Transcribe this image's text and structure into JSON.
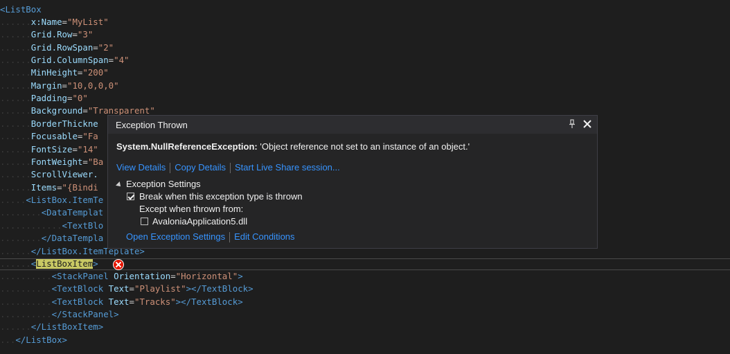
{
  "editor": {
    "lines": [
      {
        "dots": "",
        "parts": [
          {
            "c": "tag",
            "t": "<ListBox"
          }
        ]
      },
      {
        "dots": "......",
        "parts": [
          {
            "c": "attr",
            "t": "x:Name"
          },
          {
            "c": "plain",
            "t": "="
          },
          {
            "c": "val",
            "t": "\"MyList\""
          }
        ]
      },
      {
        "dots": "......",
        "parts": [
          {
            "c": "attr",
            "t": "Grid.Row"
          },
          {
            "c": "plain",
            "t": "="
          },
          {
            "c": "val",
            "t": "\"3\""
          }
        ]
      },
      {
        "dots": "......",
        "parts": [
          {
            "c": "attr",
            "t": "Grid.RowSpan"
          },
          {
            "c": "plain",
            "t": "="
          },
          {
            "c": "val",
            "t": "\"2\""
          }
        ]
      },
      {
        "dots": "......",
        "parts": [
          {
            "c": "attr",
            "t": "Grid.ColumnSpan"
          },
          {
            "c": "plain",
            "t": "="
          },
          {
            "c": "val",
            "t": "\"4\""
          }
        ]
      },
      {
        "dots": "......",
        "parts": [
          {
            "c": "attr",
            "t": "MinHeight"
          },
          {
            "c": "plain",
            "t": "="
          },
          {
            "c": "val",
            "t": "\"200\""
          }
        ]
      },
      {
        "dots": "......",
        "parts": [
          {
            "c": "attr",
            "t": "Margin"
          },
          {
            "c": "plain",
            "t": "="
          },
          {
            "c": "val",
            "t": "\"10,0,0,0\""
          }
        ]
      },
      {
        "dots": "......",
        "parts": [
          {
            "c": "attr",
            "t": "Padding"
          },
          {
            "c": "plain",
            "t": "="
          },
          {
            "c": "val",
            "t": "\"0\""
          }
        ]
      },
      {
        "dots": "......",
        "parts": [
          {
            "c": "attr",
            "t": "Background"
          },
          {
            "c": "plain",
            "t": "="
          },
          {
            "c": "val",
            "t": "\"Transparent\""
          }
        ]
      },
      {
        "dots": "......",
        "parts": [
          {
            "c": "attr",
            "t": "BorderThickne"
          }
        ]
      },
      {
        "dots": "......",
        "parts": [
          {
            "c": "attr",
            "t": "Focusable"
          },
          {
            "c": "plain",
            "t": "="
          },
          {
            "c": "val",
            "t": "\"Fa"
          }
        ]
      },
      {
        "dots": "......",
        "parts": [
          {
            "c": "attr",
            "t": "FontSize"
          },
          {
            "c": "plain",
            "t": "="
          },
          {
            "c": "val",
            "t": "\"14\""
          }
        ]
      },
      {
        "dots": "......",
        "parts": [
          {
            "c": "attr",
            "t": "FontWeight"
          },
          {
            "c": "plain",
            "t": "="
          },
          {
            "c": "val",
            "t": "\"Ba"
          }
        ]
      },
      {
        "dots": "......",
        "parts": [
          {
            "c": "attr",
            "t": "ScrollViewer."
          }
        ]
      },
      {
        "dots": "......",
        "parts": [
          {
            "c": "attr",
            "t": "Items"
          },
          {
            "c": "plain",
            "t": "="
          },
          {
            "c": "val",
            "t": "\"{Bindi"
          }
        ]
      },
      {
        "dots": ".....",
        "parts": [
          {
            "c": "tag",
            "t": "<ListBox.ItemTe"
          }
        ]
      },
      {
        "dots": "........",
        "parts": [
          {
            "c": "tag",
            "t": "<DataTemplat"
          }
        ]
      },
      {
        "dots": "............",
        "parts": [
          {
            "c": "tag",
            "t": "<TextBlo"
          }
        ]
      },
      {
        "dots": "........",
        "parts": [
          {
            "c": "tag",
            "t": "</DataTempla"
          }
        ]
      },
      {
        "dots": "......",
        "parts": [
          {
            "c": "tag",
            "t": "</ListBox.ItemTe"
          },
          {
            "c": "tag",
            "t": "plate>"
          }
        ]
      },
      {
        "dots": "......",
        "parts": [
          {
            "c": "tag",
            "t": "<"
          },
          {
            "c": "hl",
            "t": "ListBoxItem"
          },
          {
            "c": "tag",
            "t": ">"
          }
        ]
      },
      {
        "dots": "..........",
        "parts": [
          {
            "c": "tag",
            "t": "<StackPanel "
          },
          {
            "c": "attr",
            "t": "Orientation"
          },
          {
            "c": "plain",
            "t": "="
          },
          {
            "c": "val",
            "t": "\"Horizontal\""
          },
          {
            "c": "tag",
            "t": ">"
          }
        ]
      },
      {
        "dots": "..........",
        "parts": [
          {
            "c": "tag",
            "t": "<TextBlock "
          },
          {
            "c": "attr",
            "t": "Text"
          },
          {
            "c": "plain",
            "t": "="
          },
          {
            "c": "val",
            "t": "\"Playlist\""
          },
          {
            "c": "tag",
            "t": "></TextBlock>"
          }
        ]
      },
      {
        "dots": "..........",
        "parts": [
          {
            "c": "tag",
            "t": "<TextBlock "
          },
          {
            "c": "attr",
            "t": "Text"
          },
          {
            "c": "plain",
            "t": "="
          },
          {
            "c": "val",
            "t": "\"Tracks\""
          },
          {
            "c": "tag",
            "t": "></TextBlock>"
          }
        ]
      },
      {
        "dots": "..........",
        "parts": [
          {
            "c": "tag",
            "t": "</StackPanel>"
          }
        ]
      },
      {
        "dots": "......",
        "parts": [
          {
            "c": "tag",
            "t": "</ListBoxItem>"
          }
        ]
      },
      {
        "dots": "...",
        "parts": [
          {
            "c": "tag",
            "t": "</ListBox>"
          }
        ]
      }
    ]
  },
  "popup": {
    "title": "Exception Thrown",
    "exception_type": "System.NullReferenceException:",
    "exception_message": " 'Object reference not set to an instance of an object.'",
    "link_view_details": "View Details",
    "link_copy_details": "Copy Details",
    "link_live_share": "Start Live Share session...",
    "settings_header": "Exception Settings",
    "break_option": "Break when this exception type is thrown",
    "break_checked": true,
    "except_label": "Except when thrown from:",
    "module_option": "AvaloniaApplication5.dll",
    "module_checked": false,
    "link_open_settings": "Open Exception Settings",
    "link_edit_conditions": "Edit Conditions"
  },
  "colors": {
    "background": "#1e1e1e",
    "tag": "#569cd6",
    "attribute": "#9cdcfe",
    "string": "#ce9178",
    "link": "#3794ff",
    "error": "#e51400"
  }
}
